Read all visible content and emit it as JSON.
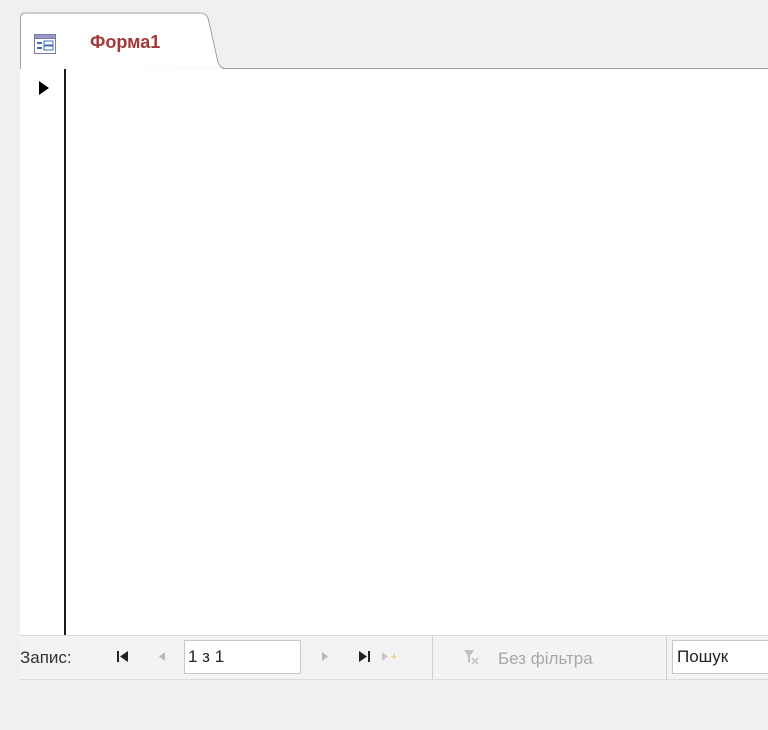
{
  "document_tab": {
    "label": "Форма1",
    "icon": "form-icon"
  },
  "form": {
    "record_selector_icon": "current-record-icon"
  },
  "navigation": {
    "record_label": "Запис:",
    "first_icon": "first-record-icon",
    "prev_icon": "previous-record-icon",
    "record_position": "1 з 1",
    "next_icon": "next-record-icon",
    "last_icon": "last-record-icon",
    "new_icon": "new-record-icon",
    "filter_icon": "filter-icon",
    "filter_label": "Без фільтра",
    "search_value": "Пошук"
  },
  "colors": {
    "tab_label": "#a4373a",
    "disabled_text": "#a8a8a8",
    "disabled_icon": "#b8b8b8"
  }
}
